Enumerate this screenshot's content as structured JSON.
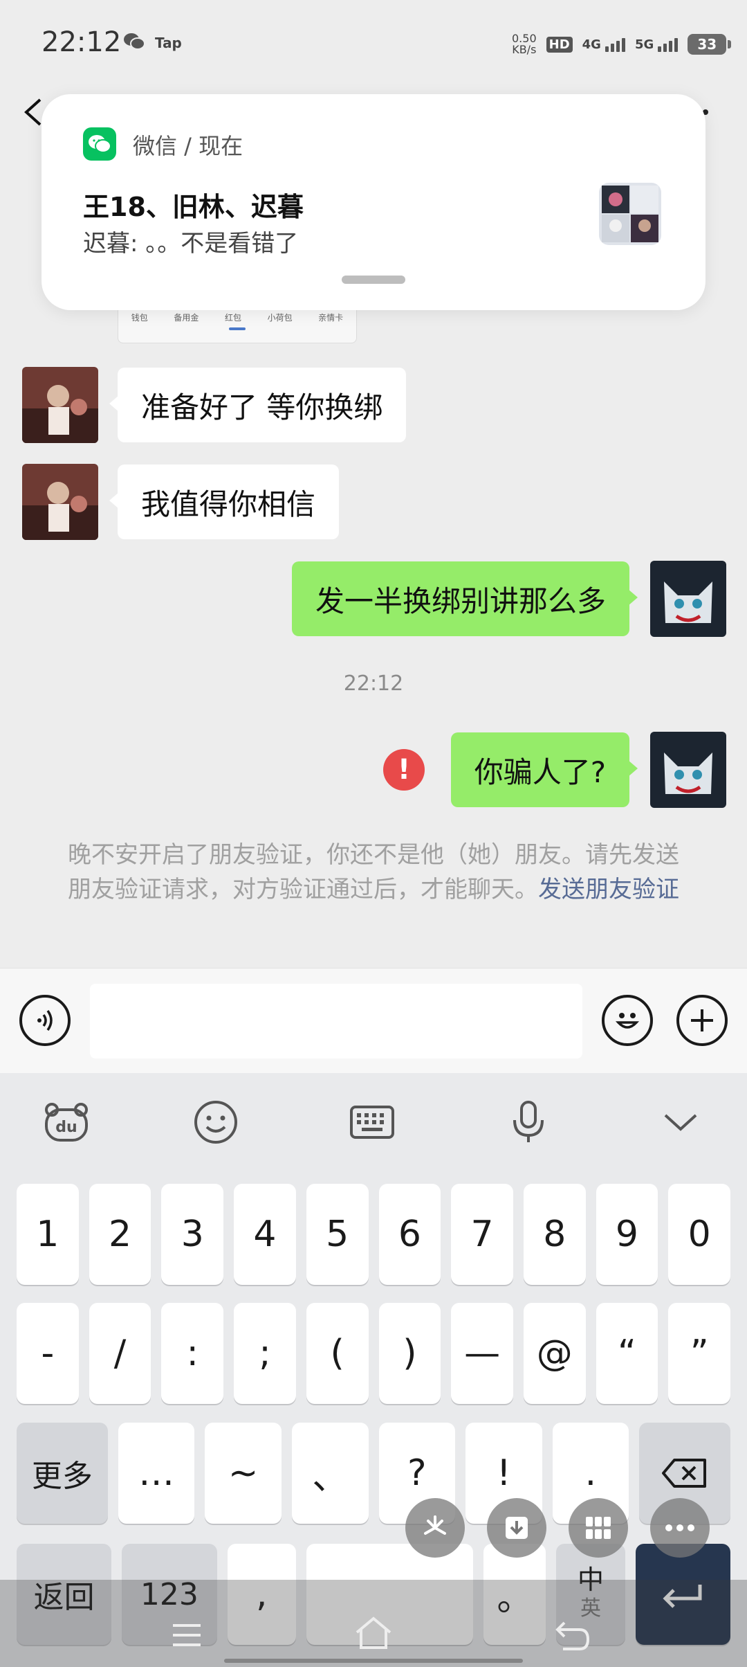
{
  "status_bar": {
    "time": "22:12",
    "tap_label": "Tap",
    "net_speed_value": "0.50",
    "net_speed_unit": "KB/s",
    "hd_label": "HD",
    "sim_slots": "1 2",
    "network_4g": "4G",
    "network_5g": "5G",
    "battery": "33"
  },
  "notification": {
    "app_name_time": "微信 / 现在",
    "title": "王18、旧林、迟暮",
    "body": "迟暮: 。。不是看错了"
  },
  "pay_card": {
    "tabs": [
      "钱包",
      "备用金",
      "红包",
      "小荷包",
      "亲情卡"
    ]
  },
  "messages": [
    {
      "side": "left",
      "text": "准备好了 等你换绑"
    },
    {
      "side": "left",
      "text": "我值得你相信"
    },
    {
      "side": "right",
      "text": "发一半换绑别讲那么多"
    },
    {
      "side": "right",
      "text": "你骗人了?",
      "status": "failed"
    }
  ],
  "timestamp": "22:12",
  "system_notice": {
    "text": "晚不安开启了朋友验证，你还不是他（她）朋友。请先发送朋友验证请求，对方验证通过后，才能聊天。",
    "link": "发送朋友验证"
  },
  "input_bar": {
    "icons": [
      "voice-icon",
      "emoji-icon",
      "plus-icon"
    ]
  },
  "keyboard": {
    "toolbar_icons": [
      "du-bear-icon",
      "smiley-icon",
      "keyboard-icon",
      "mic-icon",
      "chevron-down-icon"
    ],
    "row1": [
      "1",
      "2",
      "3",
      "4",
      "5",
      "6",
      "7",
      "8",
      "9",
      "0"
    ],
    "row2": [
      "-",
      "/",
      ":",
      ";",
      "(",
      ")",
      "—",
      "@",
      "“",
      "”"
    ],
    "row3_more": "更多",
    "row3": [
      "…",
      "~",
      "、",
      "?",
      "!",
      "."
    ],
    "row4_back": "返回",
    "row4_123": "123",
    "row4_comma": ",",
    "row4_period": "。",
    "row4_lang_cn": "中",
    "row4_lang_en": "英"
  },
  "colors": {
    "wechat_green": "#07c160",
    "bubble_green": "#95ec69",
    "error_red": "#e84a4a",
    "link_blue": "#576b95",
    "enter_key": "#26364f"
  }
}
